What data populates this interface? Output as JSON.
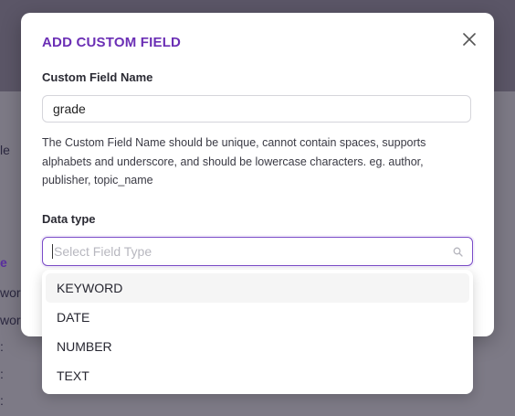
{
  "background": {
    "fragments": [
      "le",
      "e",
      "wor",
      "wor",
      ":",
      ":",
      ":"
    ]
  },
  "modal": {
    "title": "ADD CUSTOM FIELD",
    "close_icon": "close-icon",
    "name_label": "Custom Field Name",
    "name_value": "grade",
    "helper_text": "The Custom Field Name should be unique, cannot contain spaces, supports alphabets and underscore, and should be lowercase characters. eg. author, publisher, topic_name",
    "type_label": "Data type",
    "type_placeholder": "Select Field Type",
    "search_icon": "search-icon"
  },
  "dropdown": {
    "options": [
      "KEYWORD",
      "DATE",
      "NUMBER",
      "TEXT"
    ],
    "highlighted": "KEYWORD"
  },
  "colors": {
    "accent": "#6b2fb5",
    "focus_border": "#7a4bc8",
    "overlay": "#6f6b7a"
  }
}
